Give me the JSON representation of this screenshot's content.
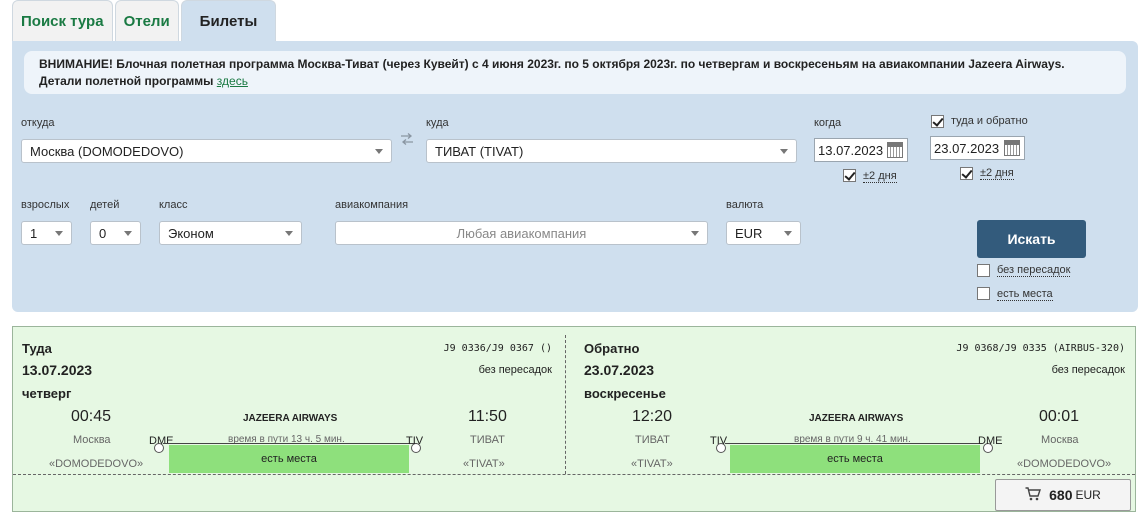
{
  "tabs": [
    {
      "label": "Поиск тура"
    },
    {
      "label": "Отели"
    },
    {
      "label": "Билеты"
    }
  ],
  "notice": {
    "text": "ВНИМАНИЕ! Блочная полетная программа Москва-Тиват (через  Кувейт) с 4 июня 2023г. по 5 октября 2023г. по четвергам и воскресеньям на авиакомпании Jazeera Airways.",
    "details_prefix": "Детали полетной программы",
    "details_link": "здесь"
  },
  "search": {
    "from_label": "откуда",
    "from_value": "Москва (DOMODEDOVO)",
    "to_label": "куда",
    "to_value": "ТИВАТ (TIVAT)",
    "when_label": "когда",
    "when_value": "13.07.2023",
    "roundtrip_label": "туда и обратно",
    "roundtrip_checked": true,
    "return_value": "23.07.2023",
    "flex_label": "±2 дня",
    "adults_label": "взрослых",
    "adults_value": "1",
    "children_label": "детей",
    "children_value": "0",
    "class_label": "класс",
    "class_value": "Эконом",
    "airline_label": "авиакомпания",
    "airline_placeholder": "Любая авиакомпания",
    "currency_label": "валюта",
    "currency_value": "EUR",
    "search_button": "Искать",
    "nonstop_label": "без пересадок",
    "available_label": "есть места"
  },
  "result": {
    "outbound": {
      "heading": "Туда",
      "date": "13.07.2023",
      "weekday": "четверг",
      "flights": "J9 0336/J9 0367 ()",
      "transfers": "без пересадок",
      "dep_time": "00:45",
      "dep_city": "Москва",
      "dep_airport": "«DOMODEDOVO»",
      "dep_code": "DME",
      "airline": "JAZEERA AIRWAYS",
      "duration": "время в пути 13 ч. 5 мин.",
      "arr_code": "TIV",
      "arr_time": "11:50",
      "arr_city": "ТИВАТ",
      "arr_airport": "«TIVAT»",
      "availability": "есть места"
    },
    "inbound": {
      "heading": "Обратно",
      "date": "23.07.2023",
      "weekday": "воскресенье",
      "flights": "J9 0368/J9 0335 (AIRBUS-320)",
      "transfers": "без пересадок",
      "dep_time": "12:20",
      "dep_city": "ТИВАТ",
      "dep_airport": "«TIVAT»",
      "dep_code": "TIV",
      "airline": "JAZEERA AIRWAYS",
      "duration": "время в пути 9 ч. 41 мин.",
      "arr_code": "DME",
      "arr_time": "00:01",
      "arr_city": "Москва",
      "arr_airport": "«DOMODEDOVO»",
      "availability": "есть места"
    },
    "price": "680",
    "currency": "EUR"
  },
  "icons": {
    "swap": "swap-arrows-icon",
    "calendar": "calendar-icon",
    "cart": "shopping-cart-icon"
  }
}
